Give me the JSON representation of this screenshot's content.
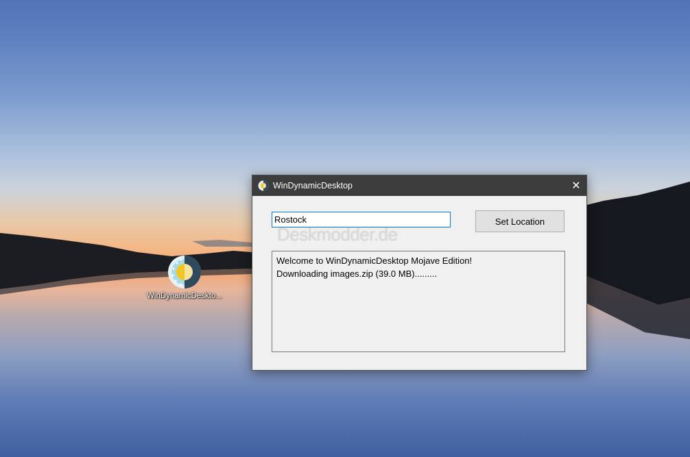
{
  "desktop": {
    "icon_label": "WinDynamicDeskto...",
    "icon_name": "windynamicdesktop-sun-icon"
  },
  "window": {
    "title": "WinDynamicDesktop",
    "close_glyph": "✕",
    "location_input_value": "Rostock",
    "set_location_label": "Set Location",
    "log_lines": [
      "Welcome to WinDynamicDesktop Mojave Edition!",
      "Downloading images.zip (39.0 MB)........."
    ]
  },
  "watermark": "Deskmodder.de",
  "colors": {
    "titlebar": "#3c3c3c",
    "focus_border": "#0078d7",
    "window_bg": "#f0f0f0"
  }
}
